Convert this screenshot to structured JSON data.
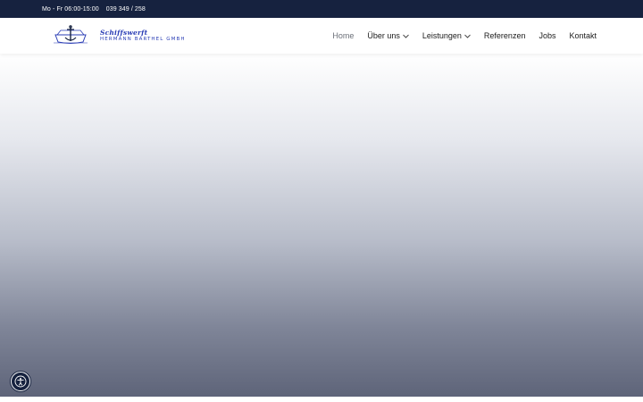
{
  "topbar": {
    "hours": "Mo - Fr 06:00-15:00",
    "phone": "039 349 / 258"
  },
  "logo": {
    "script": "Schiffswerft",
    "subtitle": "HERMANN BARTHEL GMBH",
    "icon": "ship-anchor-logo"
  },
  "nav": {
    "items": [
      {
        "label": "Home",
        "active": true
      },
      {
        "label": "Über uns",
        "dropdown": true
      },
      {
        "label": "Leistungen",
        "dropdown": true
      },
      {
        "label": "Referenzen"
      },
      {
        "label": "Jobs"
      },
      {
        "label": "Kontakt"
      }
    ]
  },
  "accessibility": {
    "icon": "accessibility-icon"
  },
  "colors": {
    "topbar": "#16223f",
    "brand": "#2a3db5",
    "hero_bottom": "#5e6479"
  }
}
